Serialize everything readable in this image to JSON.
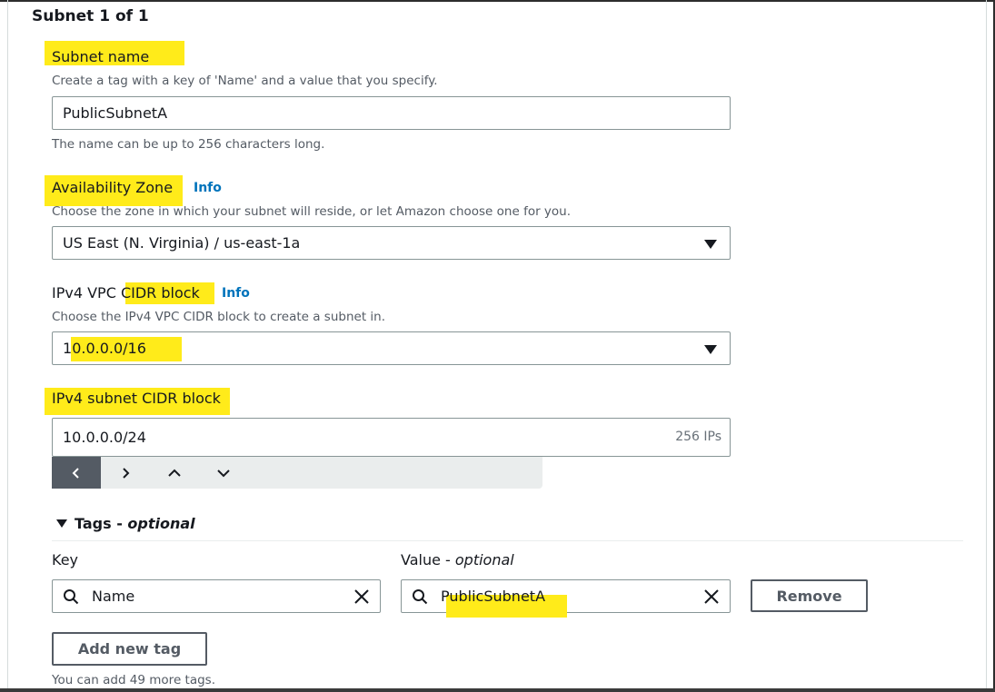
{
  "section": {
    "title": "Subnet 1 of 1"
  },
  "subnet_name": {
    "label": "Subnet name",
    "description": "Create a tag with a key of 'Name' and a value that you specify.",
    "value": "PublicSubnetA",
    "constraint": "The name can be up to 256 characters long."
  },
  "availability_zone": {
    "label": "Availability Zone",
    "info": "Info",
    "description": "Choose the zone in which your subnet will reside, or let Amazon choose one for you.",
    "selected": "US East (N. Virginia) / us-east-1a"
  },
  "vpc_cidr": {
    "label_prefix": "IPv4 VPC ",
    "label_highlight": "CIDR block",
    "info": "Info",
    "description": "Choose the IPv4 VPC CIDR block to create a subnet in.",
    "selected_first": "1",
    "selected_rest": "0.0.0.0/16"
  },
  "subnet_cidr": {
    "label": "IPv4 subnet CIDR block",
    "value": "10.0.0.0/24",
    "suffix": "256 IPs"
  },
  "stepper": {
    "icons": [
      "chevron-left-icon",
      "chevron-right-icon",
      "chevron-up-icon",
      "chevron-down-icon"
    ]
  },
  "tags": {
    "heading": "Tags",
    "heading_optional": "optional",
    "key_label": "Key",
    "value_label": "Value",
    "value_optional": "optional",
    "rows": [
      {
        "key": "Name",
        "value": "PublicSubnetA"
      }
    ],
    "remove_label": "Remove",
    "add_label": "Add new tag",
    "hint": "You can add 49 more tags."
  },
  "colors": {
    "highlight": "#ffeb1a",
    "link": "#0073bb",
    "text": "#16191f",
    "muted": "#545b64"
  }
}
